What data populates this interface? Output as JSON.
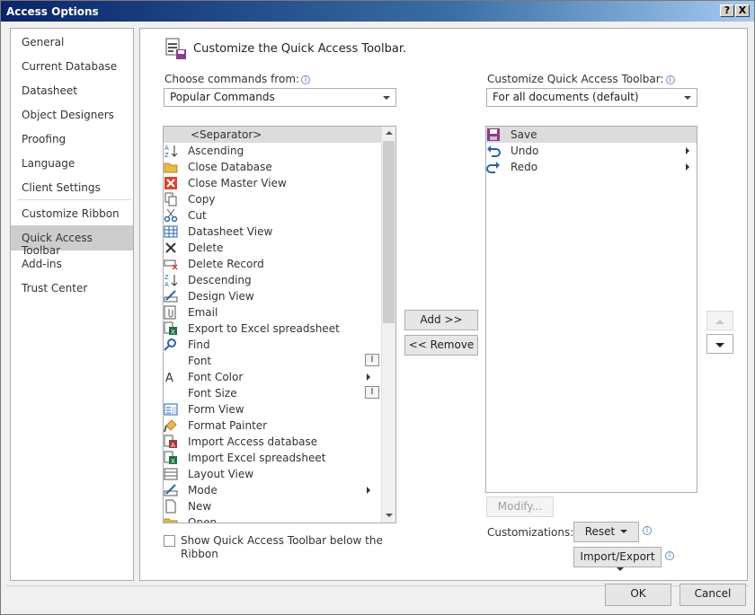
{
  "window": {
    "title": "Access Options",
    "help_glyph": "?",
    "close_glyph": "X"
  },
  "nav": {
    "items": [
      {
        "label": "General"
      },
      {
        "label": "Current Database"
      },
      {
        "label": "Datasheet"
      },
      {
        "label": "Object Designers"
      },
      {
        "label": "Proofing"
      },
      {
        "label": "Language"
      },
      {
        "label": "Client Settings"
      },
      {
        "label": "Customize Ribbon"
      },
      {
        "label": "Quick Access Toolbar",
        "selected": true
      },
      {
        "label": "Add-ins"
      },
      {
        "label": "Trust Center"
      }
    ]
  },
  "header": {
    "title": "Customize the Quick Access Toolbar."
  },
  "left": {
    "choose_label": "Choose commands from:",
    "choose_value": "Popular Commands",
    "commands": [
      {
        "label": "<Separator>",
        "icon": "none",
        "selected": true
      },
      {
        "label": "Ascending",
        "icon": "sort-ascending-icon"
      },
      {
        "label": "Close Database",
        "icon": "folder-icon"
      },
      {
        "label": "Close Master View",
        "icon": "close-red-icon"
      },
      {
        "label": "Copy",
        "icon": "copy-icon"
      },
      {
        "label": "Cut",
        "icon": "scissors-icon"
      },
      {
        "label": "Datasheet View",
        "icon": "table-icon"
      },
      {
        "label": "Delete",
        "icon": "x-icon"
      },
      {
        "label": "Delete Record",
        "icon": "delete-record-icon"
      },
      {
        "label": "Descending",
        "icon": "sort-descending-icon"
      },
      {
        "label": "Design View",
        "icon": "design-view-icon"
      },
      {
        "label": "Email",
        "icon": "attachment-icon"
      },
      {
        "label": "Export to Excel spreadsheet",
        "icon": "excel-export-icon"
      },
      {
        "label": "Find",
        "icon": "find-icon"
      },
      {
        "label": "Font",
        "icon": "none",
        "extra": "text-field"
      },
      {
        "label": "Font Color",
        "icon": "font-color-icon",
        "extra": "submenu"
      },
      {
        "label": "Font Size",
        "icon": "none",
        "extra": "text-field"
      },
      {
        "label": "Form View",
        "icon": "form-view-icon"
      },
      {
        "label": "Format Painter",
        "icon": "brush-icon"
      },
      {
        "label": "Import Access database",
        "icon": "access-import-icon"
      },
      {
        "label": "Import Excel spreadsheet",
        "icon": "excel-import-icon"
      },
      {
        "label": "Layout View",
        "icon": "layout-view-icon"
      },
      {
        "label": "Mode",
        "icon": "mode-icon",
        "extra": "submenu"
      },
      {
        "label": "New",
        "icon": "new-document-icon"
      },
      {
        "label": "Open",
        "icon": "folder-icon"
      }
    ],
    "show_below_label_line1": "Show Quick Access Toolbar below the",
    "show_below_label_line2": "Ribbon",
    "show_below_checked": false
  },
  "middle": {
    "add_label": "Add >>",
    "remove_label": "<< Remove"
  },
  "right": {
    "customize_label": "Customize Quick Access Toolbar:",
    "customize_value": "For all documents (default)",
    "toolbar_items": [
      {
        "label": "Save",
        "icon": "save-icon",
        "selected": true
      },
      {
        "label": "Undo",
        "icon": "undo-icon",
        "submenu": true
      },
      {
        "label": "Redo",
        "icon": "redo-icon",
        "submenu": true
      }
    ],
    "modify_label": "Modify...",
    "customizations_label": "Customizations:",
    "reset_label": "Reset",
    "import_export_label": "Import/Export"
  },
  "footer": {
    "ok_label": "OK",
    "cancel_label": "Cancel"
  },
  "colors": {
    "selected_bg": "#dcdcdc",
    "nav_selected_bg": "#cdcdcd",
    "titlebar_start": "#0a246a",
    "titlebar_end": "#a6caf0"
  }
}
